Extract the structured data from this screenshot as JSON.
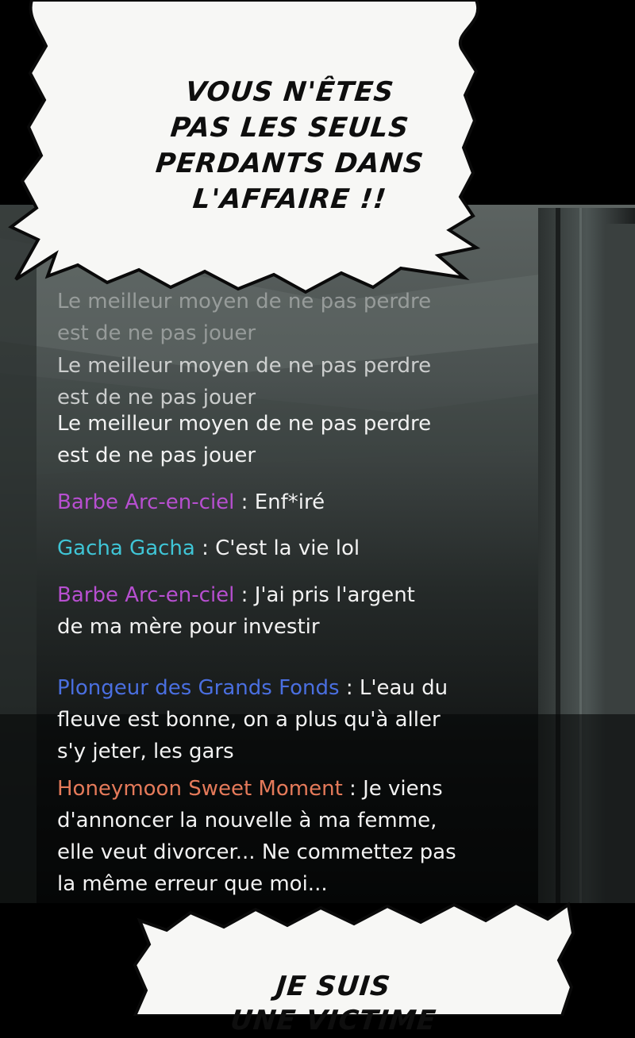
{
  "top_bubble": {
    "lines": [
      "VOUS N'ÊTES",
      "PAS LES SEULS",
      "PERDANTS DANS",
      "L'AFFAIRE !!"
    ]
  },
  "repeated_phrase": {
    "line1": "Le meilleur moyen de ne pas perdre",
    "line2": "est de ne pas jouer"
  },
  "separator": " : ",
  "messages": [
    {
      "user": "Barbe Arc-en-ciel",
      "user_color": "#b74fd0",
      "text": "Enf*iré"
    },
    {
      "user": "Gacha Gacha",
      "user_color": "#3fc5d6",
      "text": "C'est la vie lol"
    },
    {
      "user": "Barbe Arc-en-ciel",
      "user_color": "#b74fd0",
      "text": "J'ai pris l'argent",
      "text2": "de ma mère pour investir"
    },
    {
      "user": "Plongeur des Grands Fonds",
      "user_color": "#4a6fe0",
      "text": "L'eau du",
      "text2": "fleuve est bonne, on a plus qu'à aller",
      "text3": "s'y jeter, les gars"
    },
    {
      "user": "Honeymoon Sweet Moment",
      "user_color": "#e57a5a",
      "text": "Je viens",
      "text2": "d'annoncer la nouvelle à ma femme,",
      "text3": "elle veut divorcer... Ne commettez pas",
      "text4": "la même erreur que moi..."
    }
  ],
  "bottom_bubble": {
    "lines": [
      "JE SUIS",
      "UNE VICTIME"
    ]
  }
}
